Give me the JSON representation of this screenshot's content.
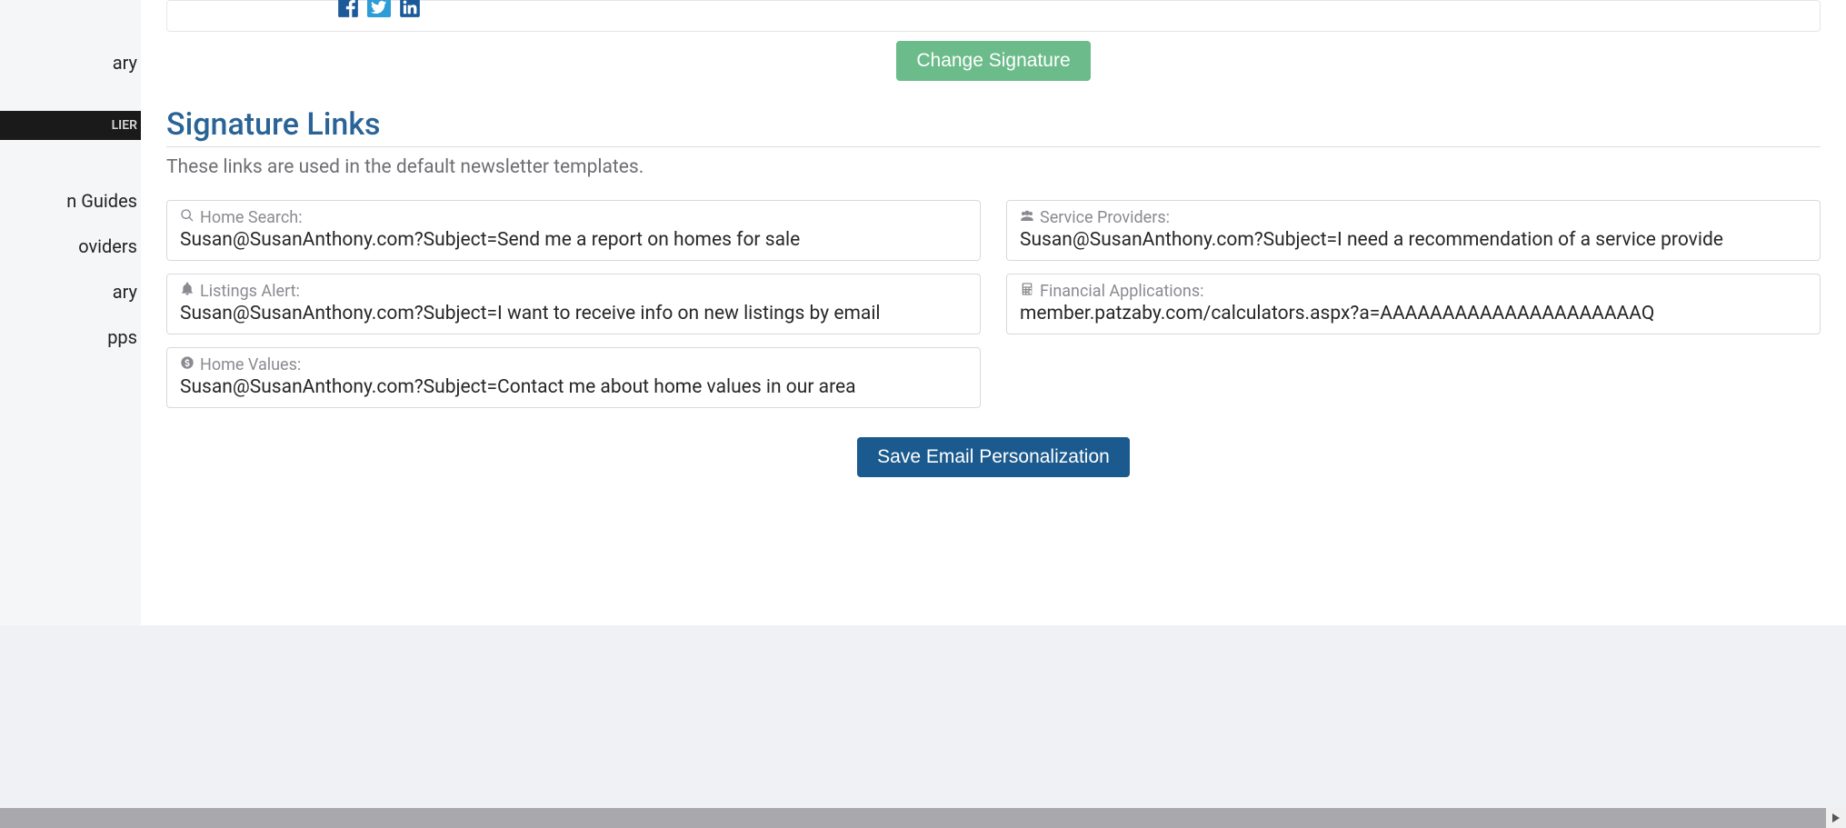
{
  "sidebar": {
    "items": [
      {
        "label": "ary"
      },
      {
        "label": "LIER",
        "active": true
      },
      {
        "label": "n Guides"
      },
      {
        "label": "oviders"
      },
      {
        "label": "ary"
      },
      {
        "label": "pps"
      }
    ]
  },
  "buttons": {
    "change_signature": "Change Signature",
    "save": "Save Email Personalization"
  },
  "section": {
    "title": "Signature Links",
    "subtitle": "These links are used in the default newsletter templates."
  },
  "links": [
    {
      "icon": "search",
      "label": "Home Search:",
      "value": "Susan@SusanAnthony.com?Subject=Send me a report on homes for sale"
    },
    {
      "icon": "users",
      "label": "Service Providers:",
      "value": "Susan@SusanAnthony.com?Subject=I need a recommendation of a service provide"
    },
    {
      "icon": "bell",
      "label": "Listings Alert:",
      "value": "Susan@SusanAnthony.com?Subject=I want to receive info on new listings by email"
    },
    {
      "icon": "calc",
      "label": "Financial Applications:",
      "value": "member.patzaby.com/calculators.aspx?a=AAAAAAAAAAAAAAAAAAAAAQ"
    },
    {
      "icon": "dollar",
      "label": "Home Values:",
      "value": "Susan@SusanAnthony.com?Subject=Contact me about home values in our area"
    }
  ]
}
